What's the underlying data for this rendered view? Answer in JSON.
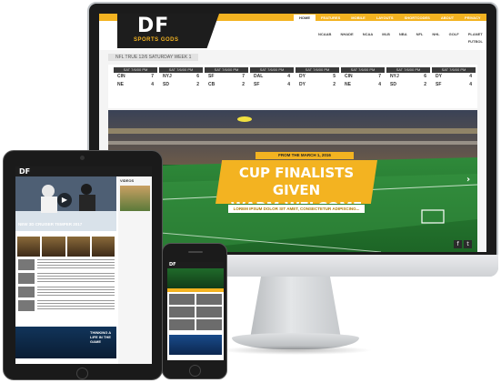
{
  "desktop": {
    "logo": {
      "mark": "DF",
      "tagline": "SPORTS GODS"
    },
    "primary_nav": [
      {
        "label": "HOME",
        "active": true
      },
      {
        "label": "FEATURES",
        "active": false
      },
      {
        "label": "MOBILE UI",
        "active": false
      },
      {
        "label": "LAYOUTS",
        "active": false
      },
      {
        "label": "SHORTCODES",
        "active": false
      },
      {
        "label": "ABOUT US",
        "active": false
      },
      {
        "label": "PRIVACY POLICY",
        "active": false
      }
    ],
    "secondary_nav": [
      "NCAAB",
      "NHADE",
      "NCAA",
      "MLB",
      "NBA",
      "NFL",
      "NHL",
      "GOLF",
      "PLANET FUTBOL"
    ],
    "breadcrumb": "NFL  TRUE 12/6 SATURDAY WEEK 1",
    "scores": [
      {
        "date": "SAT 7/6/00 PM",
        "home": "CIN",
        "home_score": "7",
        "away": "NE",
        "away_score": "4"
      },
      {
        "date": "SAT 7/6/00 PM",
        "home": "NYJ",
        "home_score": "6",
        "away": "SD",
        "away_score": "2"
      },
      {
        "date": "SAT 7/6/00 PM",
        "home": "SF",
        "home_score": "7",
        "away": "CB",
        "away_score": "2"
      },
      {
        "date": "SAT 7/6/00 PM",
        "home": "DAL",
        "home_score": "4",
        "away": "SF",
        "away_score": "4"
      },
      {
        "date": "SAT 7/6/00 PM",
        "home": "DY",
        "home_score": "5",
        "away": "DY",
        "away_score": "2"
      },
      {
        "date": "SAT 7/6/00 PM",
        "home": "CIN",
        "home_score": "7",
        "away": "NE",
        "away_score": "4"
      },
      {
        "date": "SAT 7/6/00 PM",
        "home": "NYJ",
        "home_score": "6",
        "away": "SD",
        "away_score": "2"
      },
      {
        "date": "SAT 7/6/00 PM",
        "home": "DY",
        "home_score": "4",
        "away": "SF",
        "away_score": "4"
      }
    ],
    "hero": {
      "kicker": "FROM THE MARCH 1, 2016",
      "title_line1": "CUP FINALISTS GIVEN",
      "title_line2": "WARM WELCOME",
      "excerpt": "LOREM IPSUM DOLOR SIT AMET, CONSECTETUR ADIPISCING...",
      "prev_icon": "‹",
      "next_icon": "›"
    },
    "share_icons": [
      "f",
      "t"
    ],
    "apple_glyph": ""
  },
  "tablet": {
    "logo": "DF",
    "headline": "NEW 3D CRUISER TEMPER 2017",
    "sidebar_title": "VIDEOS",
    "band_text": "THINKING A LIFE IN THE GAME",
    "play_icon": "▶"
  },
  "phone": {
    "logo": "DF"
  },
  "colors": {
    "accent": "#f3b321",
    "dark": "#1d1d1d",
    "pitch": "#1f6a2a"
  }
}
